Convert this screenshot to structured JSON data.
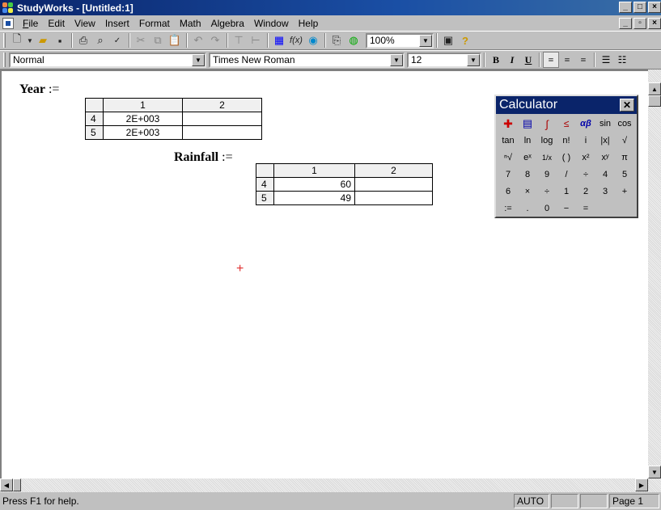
{
  "window": {
    "title": "StudyWorks - [Untitled:1]"
  },
  "menu": [
    "File",
    "Edit",
    "View",
    "Insert",
    "Format",
    "Math",
    "Algebra",
    "Window",
    "Help"
  ],
  "menu_underline": [
    "F",
    "E",
    "V",
    "I",
    "o",
    "M",
    "A",
    "W",
    "H"
  ],
  "toolbar": {
    "zoom": "100%"
  },
  "format_bar": {
    "style": "Normal",
    "font": "Times New Roman",
    "size": "12",
    "bold": "B",
    "italic": "I",
    "underline": "U"
  },
  "worksheet": {
    "year_label": "Year",
    "assign": ":=",
    "year_table": {
      "col_headers": [
        "1",
        "2"
      ],
      "rows": [
        {
          "index": "4",
          "c1": "2E+003",
          "c2": ""
        },
        {
          "index": "5",
          "c1": "2E+003",
          "c2": ""
        }
      ]
    },
    "rainfall_label": "Rainfall",
    "rainfall_table": {
      "col_headers": [
        "1",
        "2"
      ],
      "rows": [
        {
          "index": "4",
          "c1": "60",
          "c2": ""
        },
        {
          "index": "5",
          "c1": "49",
          "c2": ""
        }
      ]
    }
  },
  "calculator": {
    "title": "Calculator",
    "keys": [
      "graph",
      "matrix",
      "calculus",
      "boolean",
      "αβ",
      "sin",
      "cos",
      "tan",
      "ln",
      "log",
      "n!",
      "i",
      "|x|",
      "√",
      "ⁿ√",
      "eˣ",
      "1/x",
      "( )",
      "x²",
      "xʸ",
      "π",
      "7",
      "8",
      "9",
      "/",
      "÷",
      "4",
      "5",
      "6",
      "×",
      "÷",
      "1",
      "2",
      "3",
      "+",
      ":=",
      ".",
      "0",
      "−",
      "="
    ]
  },
  "status": {
    "help": "Press F1 for help.",
    "mode": "AUTO",
    "page": "Page 1"
  }
}
